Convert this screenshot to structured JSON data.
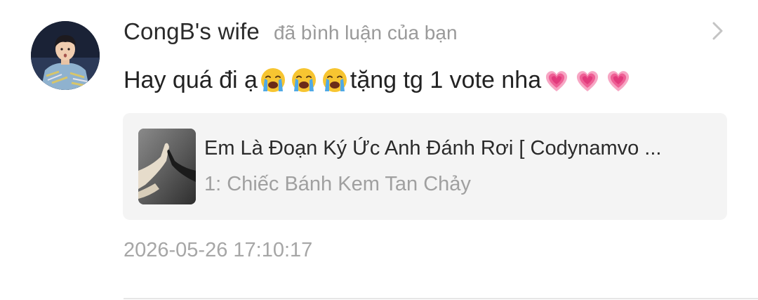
{
  "notification": {
    "username": "CongB's wife",
    "action_text": "đã bình luận của bạn",
    "comment_text": "Hay quá đi ạ",
    "comment_emojis_1": [
      "loudly-crying-face",
      "loudly-crying-face",
      "loudly-crying-face"
    ],
    "comment_text_2": "tặng tg 1 vote nha",
    "comment_emojis_2": [
      "growing-heart",
      "growing-heart",
      "growing-heart"
    ],
    "story": {
      "title": "Em Là Đoạn Ký Ức Anh Đánh Rơi [ Codynamvo ...",
      "chapter": "1: Chiếc Bánh Kem Tan Chảy"
    },
    "timestamp": "2026-05-26 17:10:17"
  },
  "icons": {
    "navigate": "chevron-right-icon"
  },
  "colors": {
    "username": "#2a2a2a",
    "secondary_text": "#9a9a9a",
    "card_background": "#f4f4f4",
    "divider": "#e6e6e6",
    "background": "#ffffff"
  }
}
